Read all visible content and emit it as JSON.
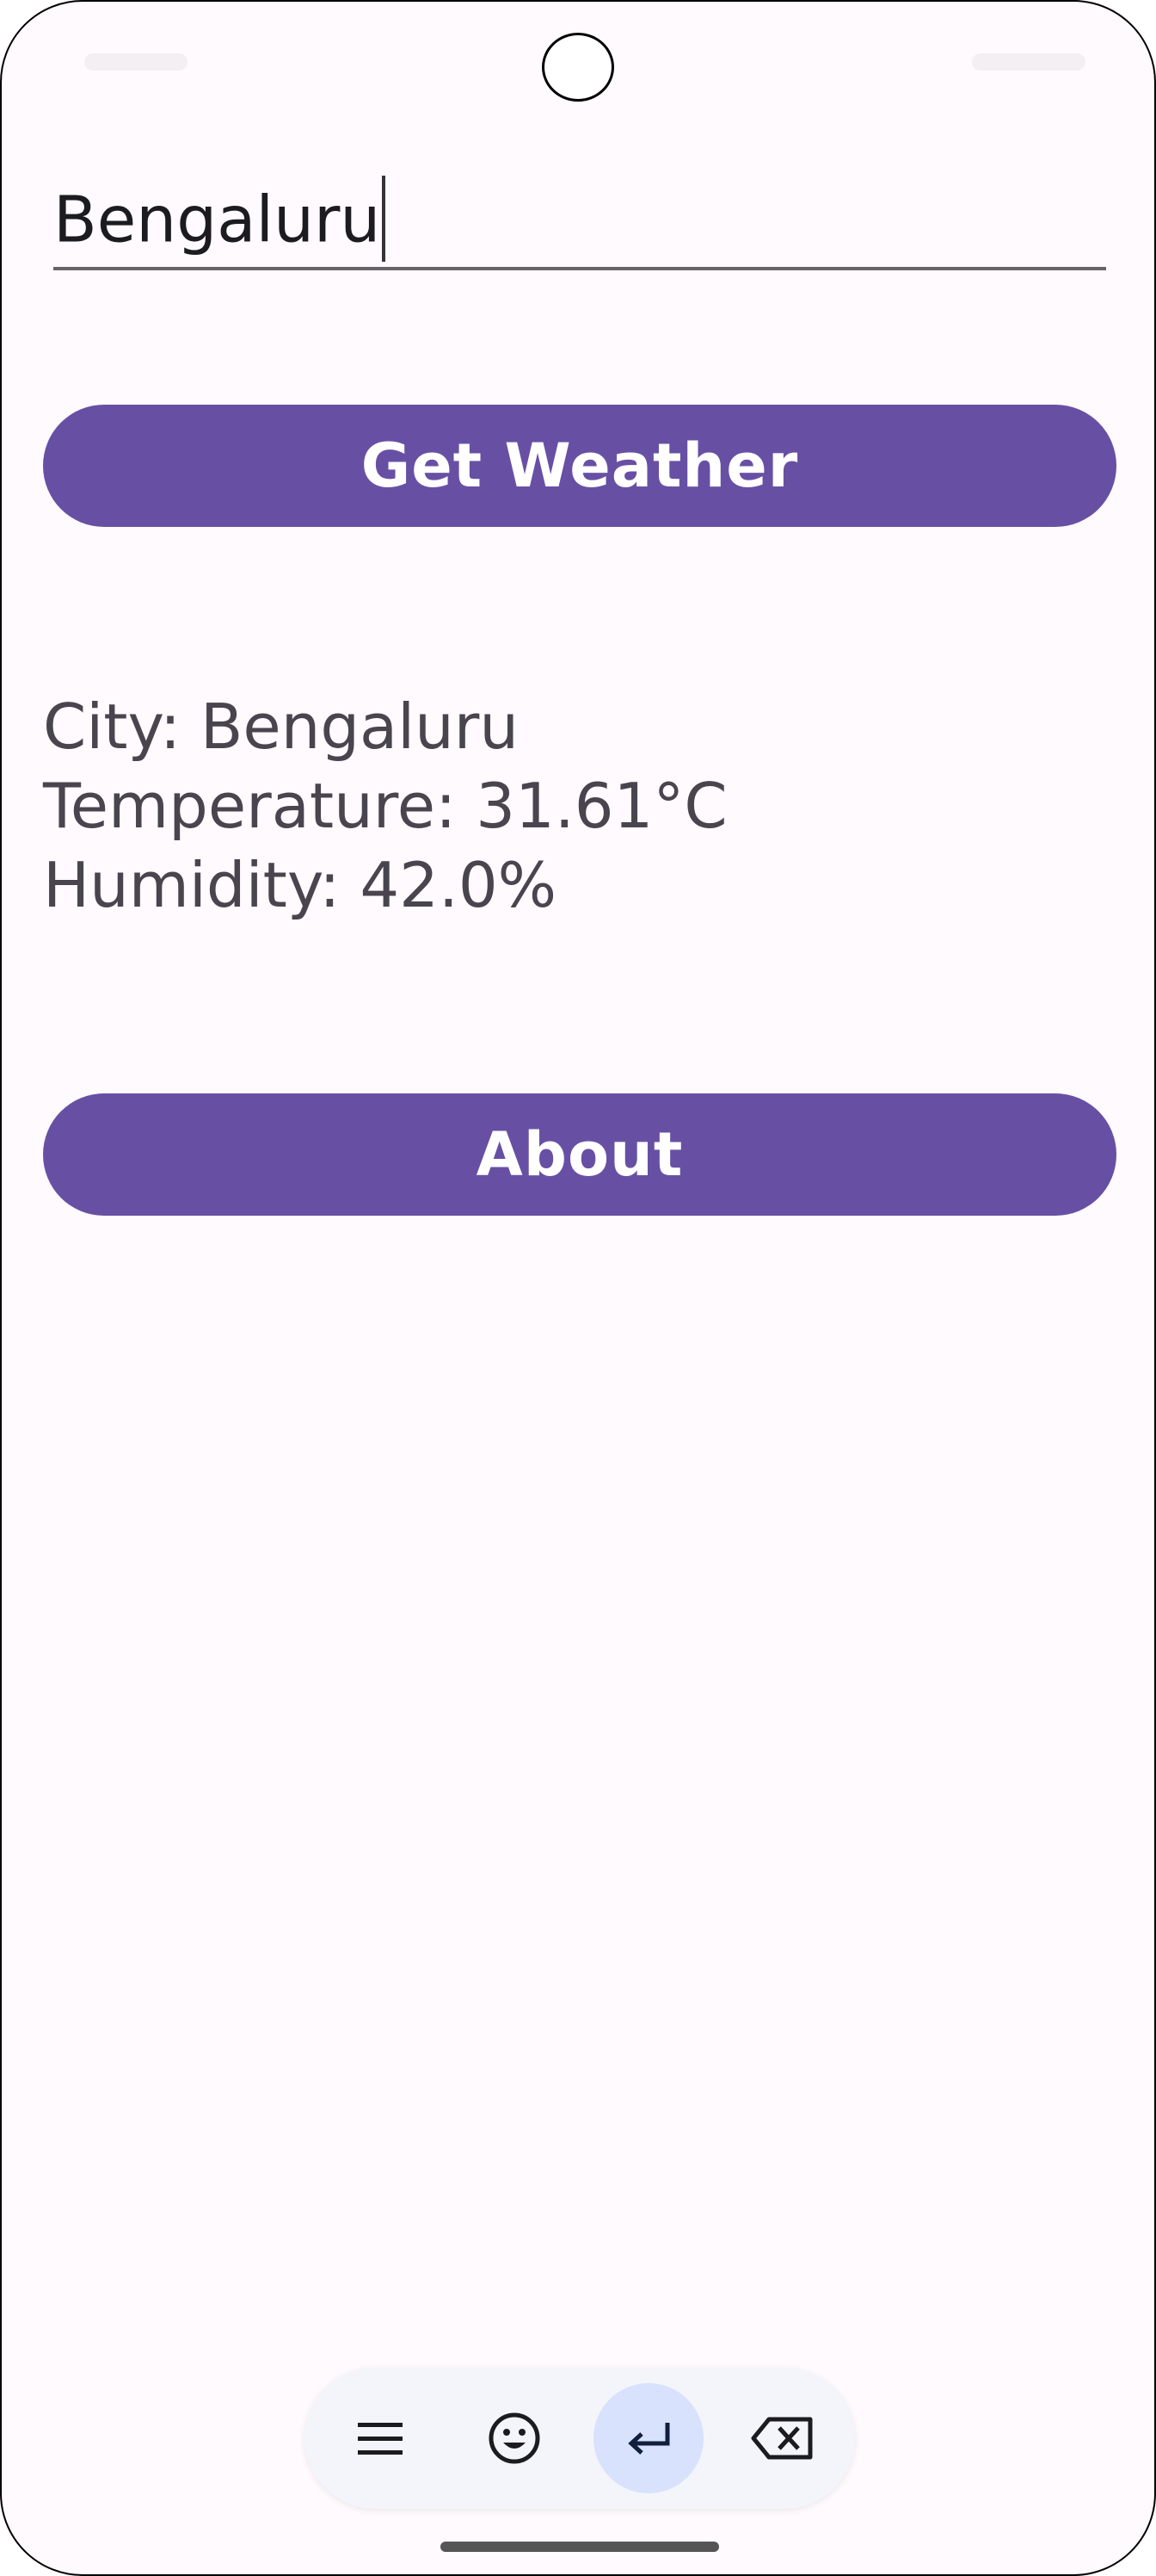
{
  "search": {
    "value": "Bengaluru"
  },
  "buttons": {
    "get_weather": "Get Weather",
    "about": "About"
  },
  "result": {
    "city_line": "City: Bengaluru",
    "temperature_line": "Temperature: 31.61°C",
    "humidity_line": "Humidity: 42.0%"
  },
  "keyboard_toolbar": {
    "icons": [
      "menu-icon",
      "emoji-icon",
      "enter-icon",
      "backspace-icon"
    ],
    "active_key": "enter-icon"
  },
  "colors": {
    "primary": "#6750a4",
    "background": "#fffafd",
    "text": "#49454f",
    "keyboard_active": "#d8e2fd"
  }
}
